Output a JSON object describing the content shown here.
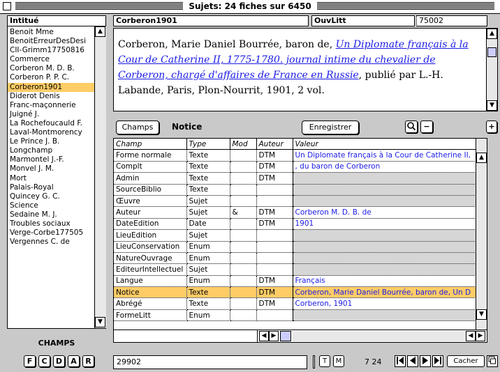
{
  "window": {
    "title": "Sujets: 24 fiches sur 6450"
  },
  "left_list": {
    "header": "Intitué",
    "items": [
      {
        "label": "Benoit Mme"
      },
      {
        "label": "BenoitErreurDesDesi"
      },
      {
        "label": "CII-Grimm17750816"
      },
      {
        "label": "Commerce"
      },
      {
        "label": "Corberon M. D. B."
      },
      {
        "label": "Corberon P. P. C."
      },
      {
        "label": "Corberon1901",
        "selected": true
      },
      {
        "label": "Diderot Denis"
      },
      {
        "label": "Franc-maçonnerie"
      },
      {
        "label": "Juigné J."
      },
      {
        "label": "La Rochefoucauld F."
      },
      {
        "label": "Laval-Montmorency"
      },
      {
        "label": "Le Prince J. B."
      },
      {
        "label": "Longchamp"
      },
      {
        "label": "Marmontel  J.-F."
      },
      {
        "label": "Monvel J. M."
      },
      {
        "label": "Mort"
      },
      {
        "label": "Palais-Royal"
      },
      {
        "label": "Quincey G. C."
      },
      {
        "label": "Science"
      },
      {
        "label": "Sedaine M. J."
      },
      {
        "label": "Troubles sociaux"
      },
      {
        "label": "Verge-Corbe177505"
      },
      {
        "label": "Vergennes C. de"
      }
    ]
  },
  "champs_label": "CHAMPS",
  "bottom_buttons": [
    "F",
    "C",
    "D",
    "A",
    "R"
  ],
  "top_fields": {
    "record_id": "Corberon1901",
    "type": "OuvLitt",
    "code": "75002"
  },
  "notice": {
    "text_start": "Corberon, Marie Daniel Bourrée, baron de, ",
    "title_italic": "Un Diplomate français à la Cour de Catherine II, 1775-1780. journal intime du chevalier de Corberon, chargé d'affaires de France en Russie",
    "text_end": ", publié par L.-H.  Labande, Paris, Plon-Nourrit, 1901, 2 vol."
  },
  "toolbar": {
    "champs_button": "Champs",
    "section_label": "Notice",
    "save_button": "Enregistrer"
  },
  "grid": {
    "columns": [
      "Champ",
      "Type",
      "Mod",
      "Auteur",
      "Valeur"
    ],
    "rows": [
      {
        "champ": "Forme normale",
        "type": "Texte",
        "mod": "",
        "auteur": "DTM",
        "valeur": "Un Diplomate français à la Cour de Catherine II,",
        "grey": false,
        "selected": false
      },
      {
        "champ": "Complt",
        "type": "Texte",
        "mod": "",
        "auteur": "DTM",
        "valeur": ", du baron de Corberon",
        "grey": false,
        "selected": false
      },
      {
        "champ": "Admin",
        "type": "Texte",
        "mod": "",
        "auteur": "DTM",
        "valeur": "",
        "grey": true,
        "selected": false
      },
      {
        "champ": "SourceBiblio",
        "type": "Texte",
        "mod": "",
        "auteur": "",
        "valeur": "",
        "grey": true,
        "selected": false
      },
      {
        "champ": "Œuvre",
        "type": "Sujet",
        "mod": "",
        "auteur": "",
        "valeur": "",
        "grey": true,
        "selected": false
      },
      {
        "champ": "Auteur",
        "type": "Sujet",
        "mod": "&",
        "auteur": "DTM",
        "valeur": "Corberon  M. D. B. de",
        "grey": false,
        "selected": false
      },
      {
        "champ": "DateEdition",
        "type": "Date",
        "mod": "",
        "auteur": "DTM",
        "valeur": "1901",
        "grey": false,
        "selected": false
      },
      {
        "champ": "LieuEdition",
        "type": "Sujet",
        "mod": "",
        "auteur": "",
        "valeur": "",
        "grey": true,
        "selected": false
      },
      {
        "champ": "LieuConservation",
        "type": "Enum",
        "mod": "",
        "auteur": "",
        "valeur": "",
        "grey": true,
        "selected": false
      },
      {
        "champ": "NatureOuvrage",
        "type": "Enum",
        "mod": "",
        "auteur": "",
        "valeur": "",
        "grey": true,
        "selected": false
      },
      {
        "champ": "EditeurIntellectuel",
        "type": "Sujet",
        "mod": "",
        "auteur": "",
        "valeur": "",
        "grey": true,
        "selected": false
      },
      {
        "champ": "Langue",
        "type": "Enum",
        "mod": "",
        "auteur": "DTM",
        "valeur": "Français",
        "grey": false,
        "selected": false
      },
      {
        "champ": "Notice",
        "type": "Texte",
        "mod": "",
        "auteur": "DTM",
        "valeur": "Corberon, Marie Daniel Bourrée, baron de, Un D",
        "grey": false,
        "selected": true
      },
      {
        "champ": "Abrégé",
        "type": "Texte",
        "mod": "",
        "auteur": "DTM",
        "valeur": "Corberon, 1901",
        "grey": false,
        "selected": false
      },
      {
        "champ": "FormeLitt",
        "type": "Enum",
        "mod": "",
        "auteur": "",
        "valeur": "",
        "grey": true,
        "selected": false
      }
    ]
  },
  "status": {
    "number": "29902",
    "t_button": "T",
    "m_button": "M",
    "position": "7 24",
    "cacher_button": "Cacher"
  },
  "colors": {
    "selection": "#ffcc66",
    "link_blue": "#1a1ae6",
    "chrome_grey": "#c9c9c9"
  },
  "icons": [
    "close-box-icon",
    "scroll-up-arrow-icon",
    "scroll-down-arrow-icon",
    "magnifier-icon",
    "minus-icon",
    "plus-icon",
    "first-record-icon",
    "previous-record-icon",
    "next-record-icon",
    "last-record-icon",
    "window-icon"
  ]
}
